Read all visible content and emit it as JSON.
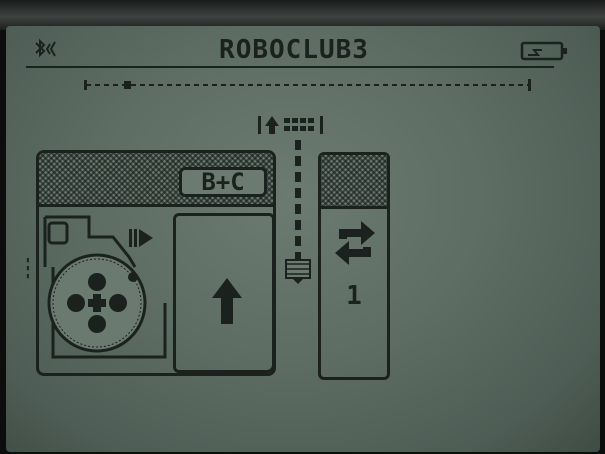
{
  "display": {
    "title": "ROBOCLUB3",
    "status": {
      "bluetooth_icon": "bluetooth-icon",
      "battery_icon": "battery-icon"
    }
  },
  "program": {
    "move_block": {
      "ports": "B+C",
      "direction_icon": "arrow-up-icon",
      "motor_icon": "motor-wheel-icon",
      "play_icon": "play-forward-icon"
    },
    "loop_block": {
      "icon": "loop-cycle-icon",
      "count": "1"
    }
  },
  "colors": {
    "lcd_background": "#5d6d64",
    "lcd_ink": "#1b211e"
  }
}
